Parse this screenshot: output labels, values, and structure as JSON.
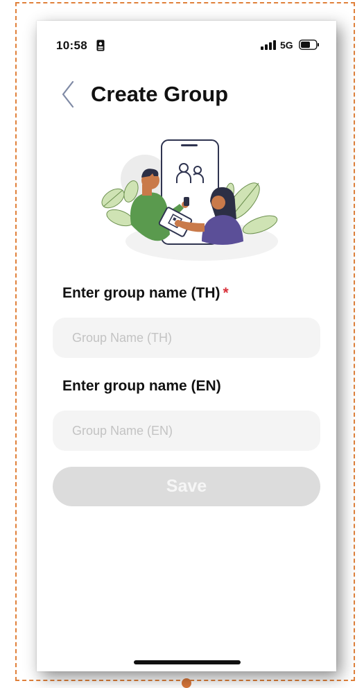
{
  "status_bar": {
    "time": "10:58",
    "network": "5G",
    "icons": [
      "id-card-icon",
      "signal-bars-icon",
      "battery-icon"
    ]
  },
  "header": {
    "back_icon": "chevron-left-icon",
    "title": "Create Group"
  },
  "illustration": {
    "name": "two-people-sharing-qr-code-illustration",
    "icons": [
      "group-users-icon",
      "phone-icon",
      "tablet-icon",
      "leaf-icon"
    ]
  },
  "form": {
    "name_th": {
      "label": "Enter group name (TH)",
      "required_mark": "*",
      "value": "",
      "placeholder": "Group Name (TH)"
    },
    "name_en": {
      "label": "Enter group name (EN)",
      "value": "",
      "placeholder": "Group Name (EN)"
    },
    "save_label": "Save"
  },
  "colors": {
    "frame_dash": "#e0803a",
    "required": "#d9323b",
    "input_bg": "#f4f4f4",
    "button_disabled_bg": "#dcdcdc",
    "illustration_green": "#5a9a4e",
    "illustration_purple": "#5b4f98",
    "illustration_leaf": "#cfe3b4"
  }
}
